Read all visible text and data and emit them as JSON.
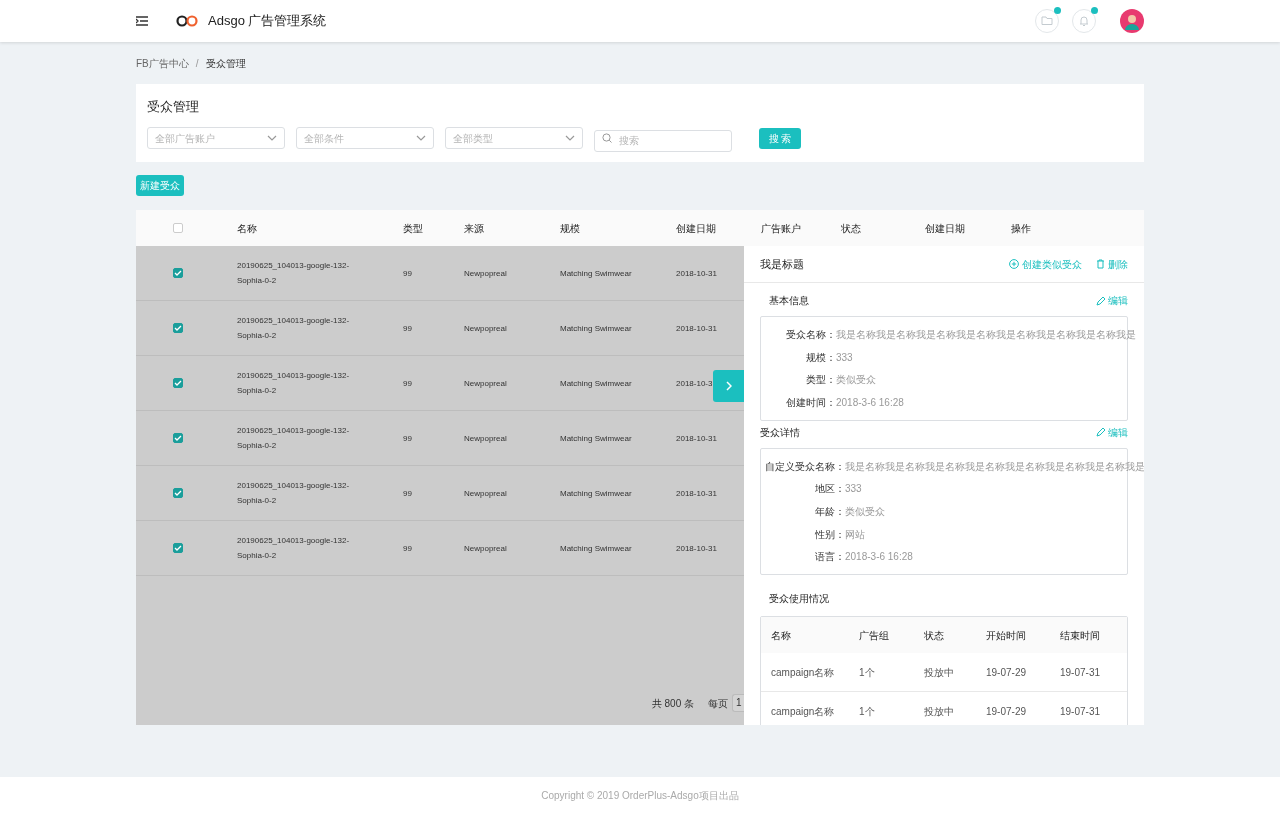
{
  "header": {
    "app_name": "Adsgo 广告管理系统",
    "notifications": [
      {
        "kind": "folder",
        "unread": true
      },
      {
        "kind": "bell",
        "unread": true
      }
    ]
  },
  "breadcrumb": {
    "separator": "/",
    "items": [
      "FB广告中心",
      "受众管理"
    ]
  },
  "filter": {
    "title": "受众管理",
    "dropdowns": [
      {
        "placeholder": "全部广告账户"
      },
      {
        "placeholder": "全部条件"
      },
      {
        "placeholder": "全部类型"
      }
    ],
    "search": {
      "placeholder": "搜索"
    },
    "search_button": "搜 索"
  },
  "new_button": "新建受众",
  "table": {
    "all_checked": false,
    "columns": [
      "名称",
      "类型",
      "来源",
      "规模",
      "创建日期",
      "广告账户",
      "状态",
      "创建日期",
      "操作"
    ],
    "rows": [
      {
        "checked": true,
        "cells": [
          "20190625_104013-google-132-Sophia-0-2",
          "99",
          "Newpopreal",
          "Matching Swimwear",
          "2018-10-31"
        ]
      },
      {
        "checked": true,
        "cells": [
          "20190625_104013-google-132-Sophia-0-2",
          "99",
          "Newpopreal",
          "Matching Swimwear",
          "2018-10-31"
        ]
      },
      {
        "checked": true,
        "cells": [
          "20190625_104013-google-132-Sophia-0-2",
          "99",
          "Newpopreal",
          "Matching Swimwear",
          "2018-10-3"
        ]
      },
      {
        "checked": true,
        "cells": [
          "20190625_104013-google-132-Sophia-0-2",
          "99",
          "Newpopreal",
          "Matching Swimwear",
          "2018-10-31"
        ]
      },
      {
        "checked": true,
        "cells": [
          "20190625_104013-google-132-Sophia-0-2",
          "99",
          "Newpopreal",
          "Matching Swimwear",
          "2018-10-31"
        ]
      },
      {
        "checked": true,
        "cells": [
          "20190625_104013-google-132-Sophia-0-2",
          "99",
          "Newpopreal",
          "Matching Swimwear",
          "2018-10-31"
        ]
      }
    ],
    "total": "共 800 条",
    "per_page_label": "每页",
    "per_page_value": "1"
  },
  "drawer": {
    "title": "我是标题",
    "actions": [
      {
        "kind": "add",
        "label": "创建类似受众"
      },
      {
        "kind": "delete",
        "label": "删除"
      }
    ],
    "sections": [
      {
        "title": "基本信息",
        "edit": "编辑",
        "fields": [
          {
            "label": "受众名称：",
            "value": "我是名称我是名称我是名称我是名称我是名称我是名称我是名称我是"
          },
          {
            "label": "规模：",
            "value": "333"
          },
          {
            "label": "类型：",
            "value": "类似受众"
          },
          {
            "label": "创建时间：",
            "value": "2018-3-6 16:28"
          }
        ]
      },
      {
        "title": "受众详情",
        "edit": "编辑",
        "fields": [
          {
            "label": "自定义受众名称：",
            "value": "我是名称我是名称我是名称我是名称我是名称我是名称我是名称我是"
          },
          {
            "label": "地区：",
            "value": "333"
          },
          {
            "label": "年龄：",
            "value": "类似受众"
          },
          {
            "label": "性别：",
            "value": "网站"
          },
          {
            "label": "语言：",
            "value": "2018-3-6 16:28"
          }
        ]
      }
    ],
    "usage": {
      "title": "受众使用情况",
      "columns": [
        "名称",
        "广告组",
        "状态",
        "开始时间",
        "结束时间"
      ],
      "rows": [
        [
          "campaign名称",
          "1个",
          "投放中",
          "19-07-29",
          "19-07-31"
        ],
        [
          "campaign名称",
          "1个",
          "投放中",
          "19-07-29",
          "19-07-31"
        ]
      ]
    }
  },
  "footer": "Copyright © 2019 OrderPlus-Adsgo项目出品"
}
